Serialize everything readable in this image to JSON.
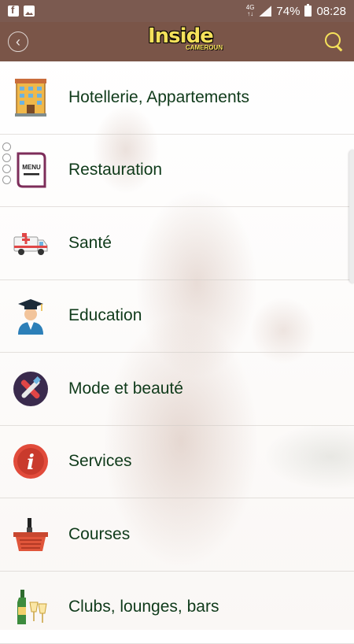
{
  "status_bar": {
    "network": "4G",
    "battery": "74%",
    "time": "08:28"
  },
  "app_bar": {
    "logo_text": "Inside",
    "logo_sub": "CAMEROUN"
  },
  "menu": {
    "items": [
      {
        "label": "Hotellerie, Appartements",
        "icon": "hotel-icon"
      },
      {
        "label": "Restauration",
        "icon": "restaurant-menu-icon"
      },
      {
        "label": "Santé",
        "icon": "ambulance-icon"
      },
      {
        "label": "Education",
        "icon": "graduate-icon"
      },
      {
        "label": "Mode et beauté",
        "icon": "beauty-icon"
      },
      {
        "label": "Services",
        "icon": "info-icon"
      },
      {
        "label": "Courses",
        "icon": "shopping-basket-icon"
      },
      {
        "label": "Clubs, lounges, bars",
        "icon": "bottle-glasses-icon"
      }
    ]
  },
  "colors": {
    "app_bar": "#7a5548",
    "accent": "#f5e15b",
    "label": "#0f3a1a"
  }
}
